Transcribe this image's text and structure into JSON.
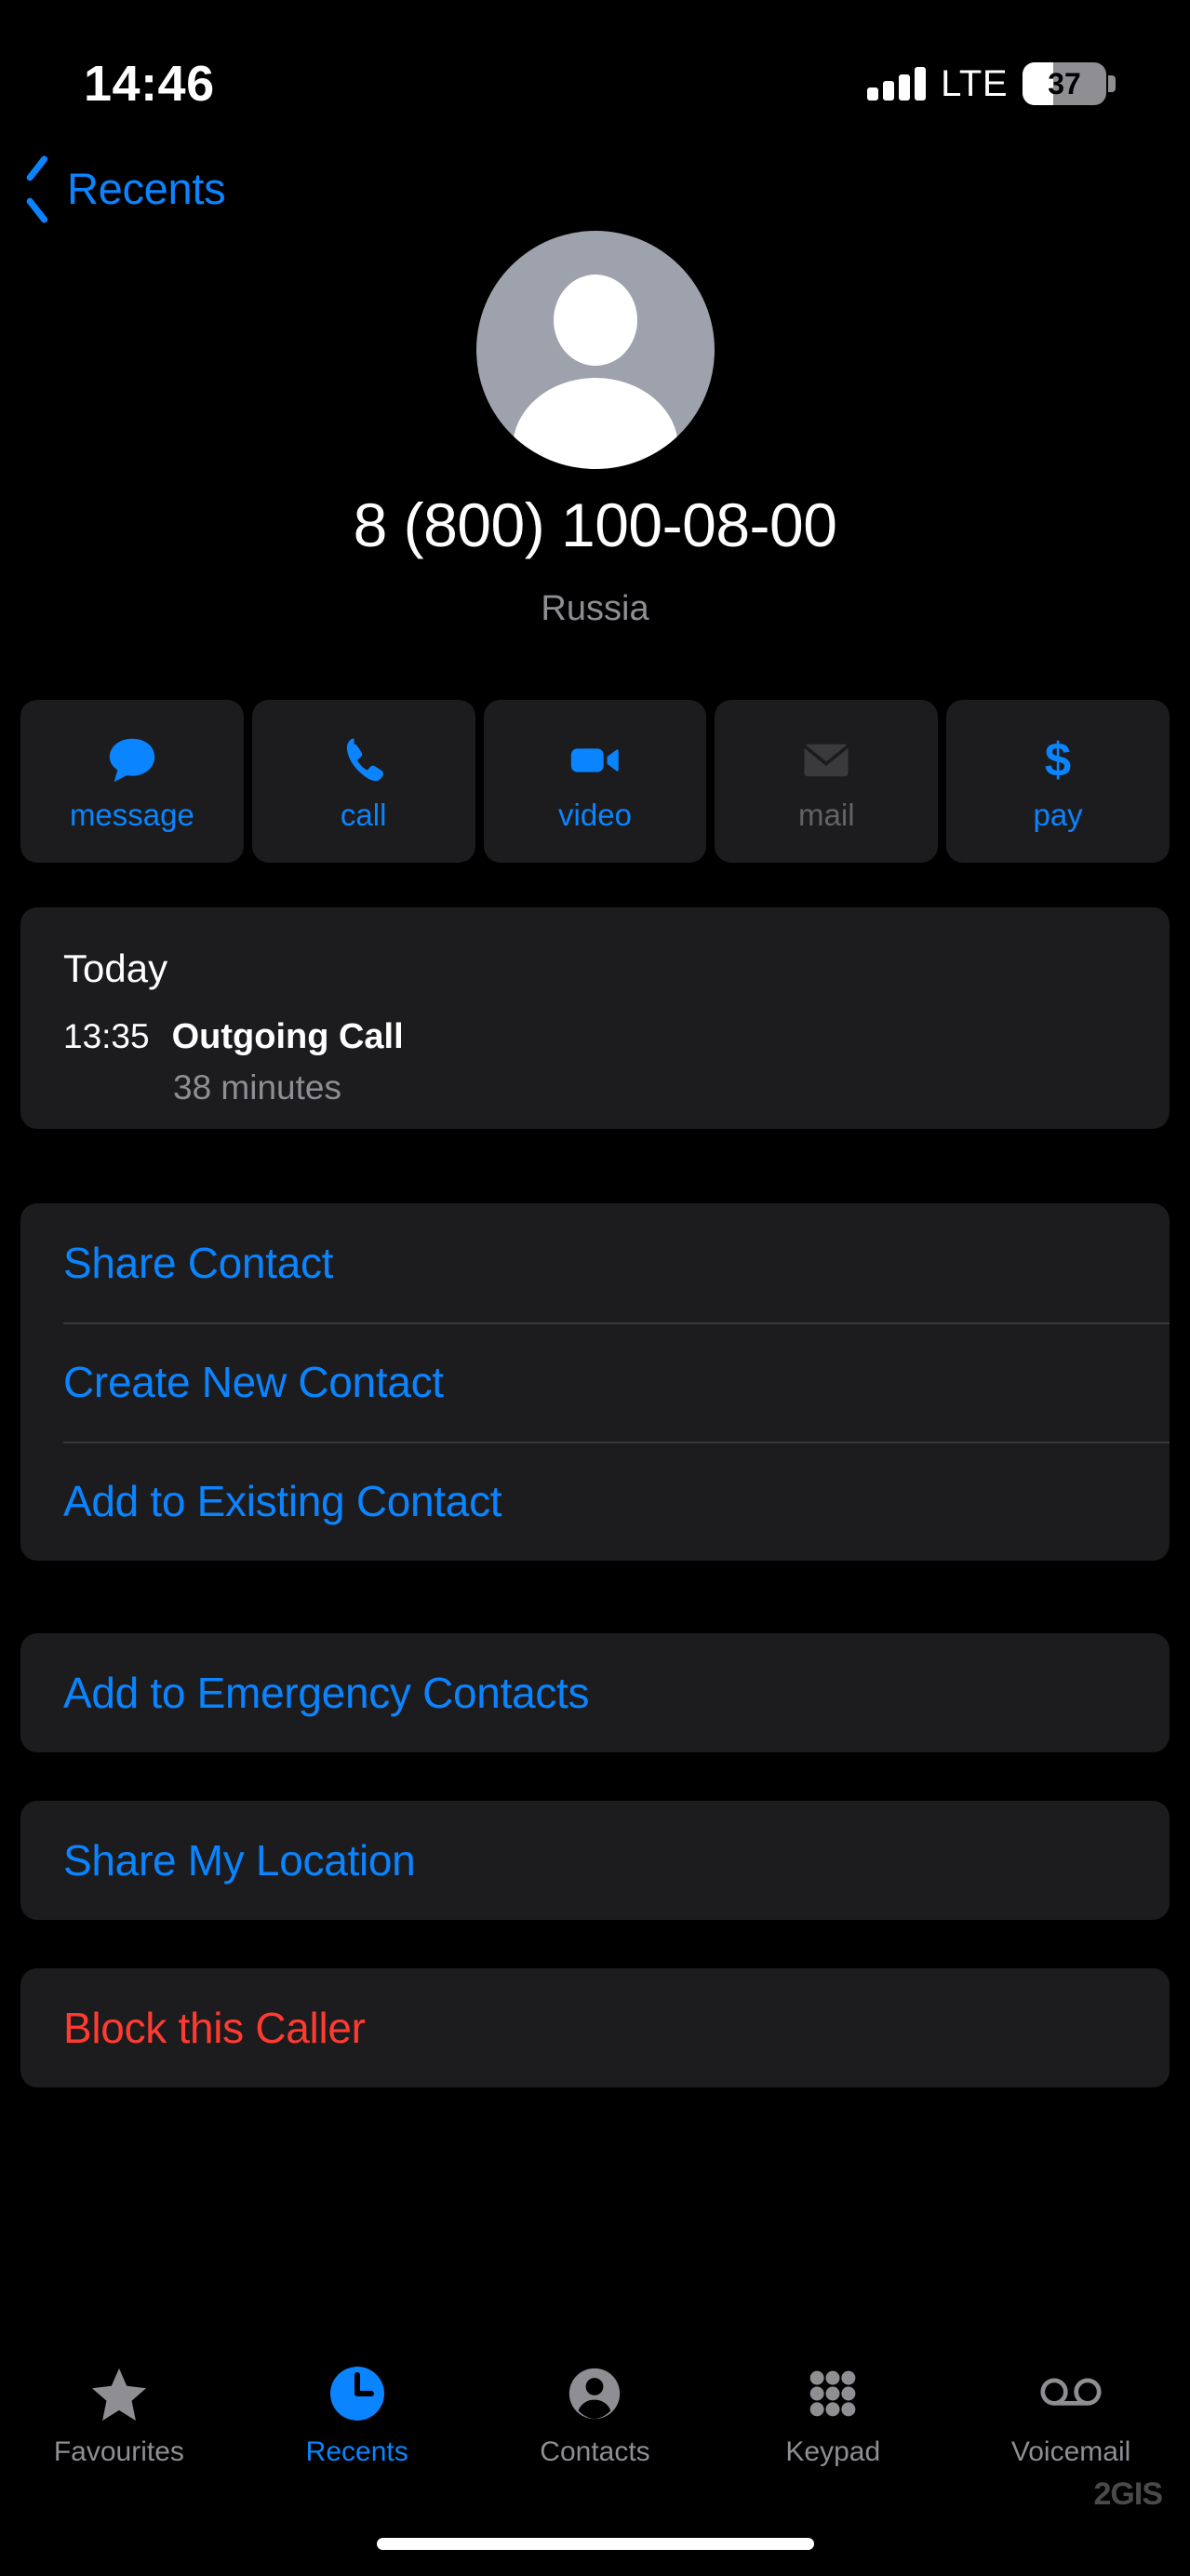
{
  "status_bar": {
    "time": "14:46",
    "network_label": "LTE",
    "signal_bars": 4,
    "battery_percent": "37",
    "battery_level": 37
  },
  "navigation": {
    "back_label": "Recents",
    "back_icon": "chevron-left-icon"
  },
  "contact": {
    "avatar_icon": "person-avatar-icon",
    "phone_number": "8 (800) 100-08-00",
    "region": "Russia"
  },
  "actions": [
    {
      "label": "message",
      "icon": "message-bubble-icon",
      "enabled": true
    },
    {
      "label": "call",
      "icon": "phone-handset-icon",
      "enabled": true
    },
    {
      "label": "video",
      "icon": "video-camera-icon",
      "enabled": true
    },
    {
      "label": "mail",
      "icon": "envelope-icon",
      "enabled": false
    },
    {
      "label": "pay",
      "icon": "dollar-sign-icon",
      "enabled": true
    }
  ],
  "call_history": {
    "day": "Today",
    "time": "13:35",
    "type": "Outgoing Call",
    "duration": "38 minutes"
  },
  "contact_actions": [
    {
      "label": "Share Contact"
    },
    {
      "label": "Create New Contact"
    },
    {
      "label": "Add to Existing Contact"
    }
  ],
  "emergency_action": {
    "label": "Add to Emergency Contacts"
  },
  "location_action": {
    "label": "Share My Location"
  },
  "block_action": {
    "label": "Block this Caller"
  },
  "tabs": [
    {
      "label": "Favourites",
      "icon": "star-icon",
      "active": false
    },
    {
      "label": "Recents",
      "icon": "clock-icon",
      "active": true
    },
    {
      "label": "Contacts",
      "icon": "person-icon",
      "active": false
    },
    {
      "label": "Keypad",
      "icon": "keypad-dots-icon",
      "active": false
    },
    {
      "label": "Voicemail",
      "icon": "voicemail-icon",
      "active": false
    }
  ],
  "watermark": {
    "text": "2GIS"
  },
  "colors": {
    "accent_blue": "#0A84FF",
    "destructive_red": "#FF3B30",
    "card_background": "#1C1C1E",
    "screen_background": "#000000",
    "secondary_text": "#8E8E93",
    "disabled_text": "#636366"
  }
}
